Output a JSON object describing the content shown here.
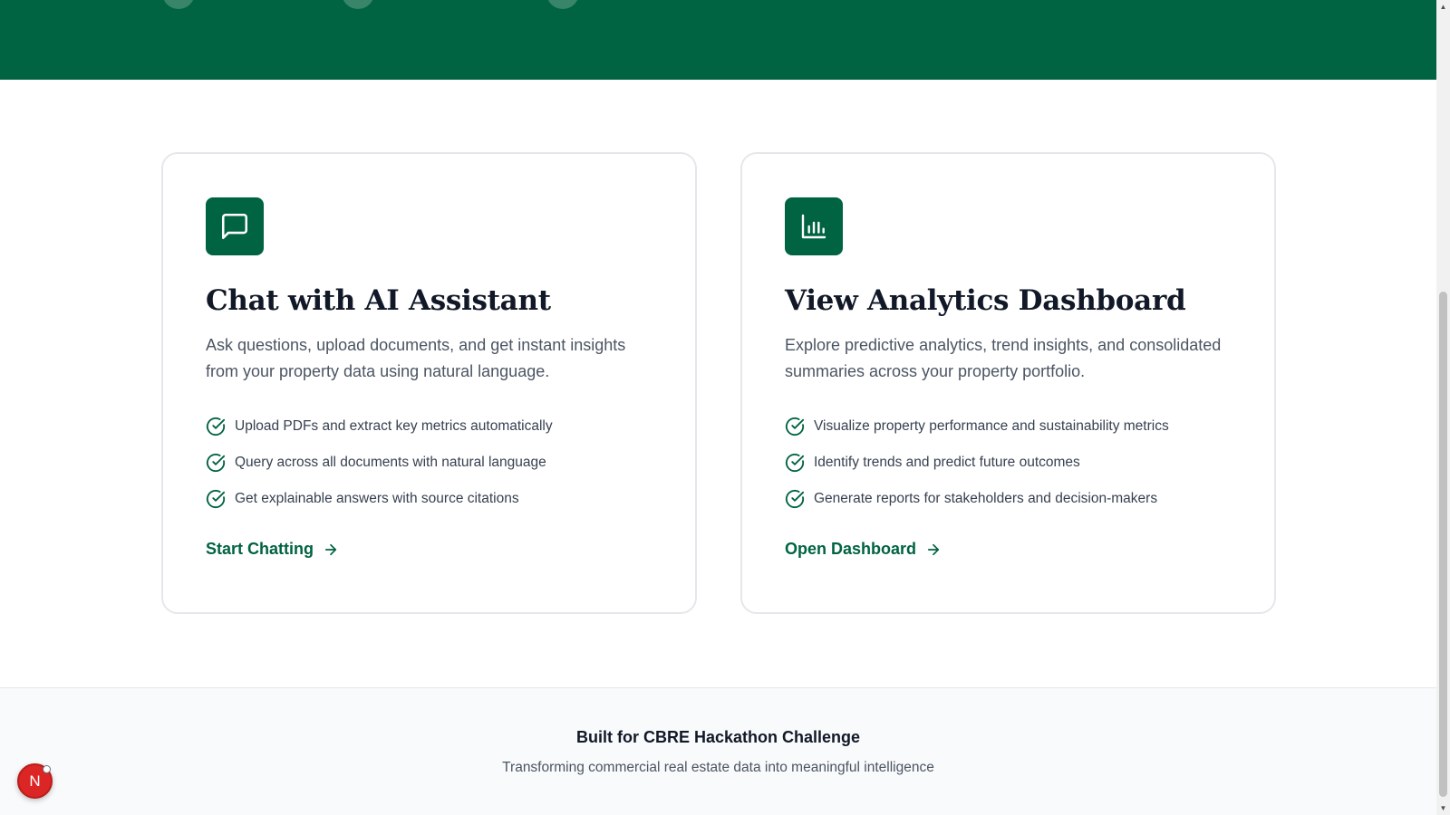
{
  "colors": {
    "brand": "#006341",
    "avatar": "#dc2626"
  },
  "cards": [
    {
      "icon": "message-square-icon",
      "title": "Chat with AI Assistant",
      "description": "Ask questions, upload documents, and get instant insights from your property data using natural language.",
      "features": [
        "Upload PDFs and extract key metrics automatically",
        "Query across all documents with natural language",
        "Get explainable answers with source citations"
      ],
      "cta": "Start Chatting"
    },
    {
      "icon": "bar-chart-icon",
      "title": "View Analytics Dashboard",
      "description": "Explore predictive analytics, trend insights, and consolidated summaries across your property portfolio.",
      "features": [
        "Visualize property performance and sustainability metrics",
        "Identify trends and predict future outcomes",
        "Generate reports for stakeholders and decision-makers"
      ],
      "cta": "Open Dashboard"
    }
  ],
  "footer": {
    "title": "Built for CBRE Hackathon Challenge",
    "subtitle": "Transforming commercial real estate data into meaningful intelligence"
  },
  "avatar": {
    "initial": "N"
  }
}
